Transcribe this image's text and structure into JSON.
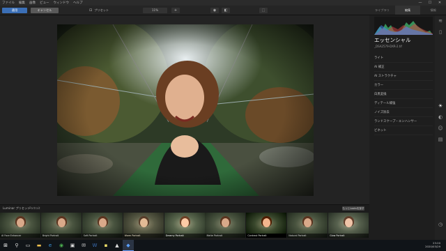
{
  "menu": [
    "ファイル",
    "編集",
    "画像",
    "ビュー",
    "ウィンドウ",
    "ヘルプ"
  ],
  "window_controls": [
    "—",
    "☐",
    "✕"
  ],
  "toolbar": {
    "apply_label": "適用",
    "cancel_label": "キャンセル",
    "preset_label": "プリセット",
    "zoom_label": "11%",
    "zoom_plus": "+"
  },
  "right_tabs": [
    "ライブラリ",
    "編集",
    "情報"
  ],
  "panel": {
    "title": "エッセンシャル",
    "filename": "_DSA2579-DXR-2.tif",
    "tools": [
      "ライト",
      "AI 補正",
      "AI ストラクチャ",
      "カラー",
      "白黒変換",
      "ディテール補強",
      "ノイズ除去",
      "ランドスケープ・エンハンサー",
      "ビネット"
    ]
  },
  "side_icons": [
    "layers-icon",
    "compare-icon",
    "sun-icon",
    "palette-icon",
    "face-icon",
    "film-icon",
    "clock-icon"
  ],
  "presets_bar": {
    "tab_luminar": "Luminar プリセット",
    "tab_portrait": "Portrait",
    "more_button": "もっとLooksを探す",
    "thumbnails": [
      "AI Face Enhancer",
      "Bright Portrait",
      "Soft Portrait",
      "Warm Portrait",
      "Dreamy Portrait",
      "Matte Portrait",
      "Contrast Portrait",
      "Natural Portrait",
      "Glow Portrait"
    ]
  },
  "taskbar": {
    "icons": [
      "windows-icon",
      "search-icon",
      "task-view-icon",
      "explorer-icon",
      "edge-icon",
      "chrome-icon",
      "store-icon",
      "mail-icon",
      "word-icon",
      "sticky-icon",
      "photos-icon",
      "luminar-icon"
    ],
    "time": "23:20",
    "date": "2020/03/29"
  }
}
